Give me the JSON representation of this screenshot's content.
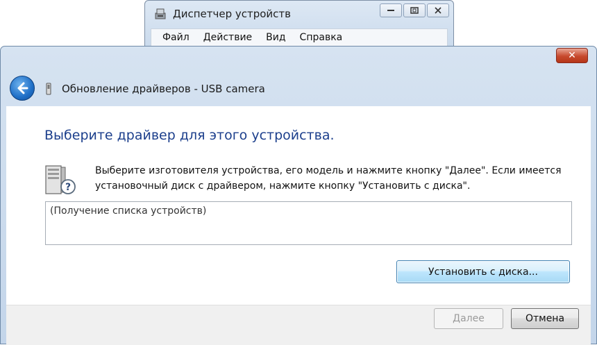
{
  "background_window": {
    "title": "Диспетчер устройств",
    "menu": [
      "Файл",
      "Действие",
      "Вид",
      "Справка"
    ]
  },
  "dialog": {
    "title": "Обновление драйверов - USB camera",
    "main_instruction": "Выберите драйвер для этого устройства.",
    "description": "Выберите изготовителя устройства, его модель и нажмите кнопку \"Далее\". Если имеется установочный диск с  драйвером, нажмите кнопку \"Установить с диска\".",
    "list_placeholder": "(Получение списка устройств)",
    "have_disk_label": "Установить с диска...",
    "next_label": "Далее",
    "cancel_label": "Отмена",
    "close_glyph": "✕"
  },
  "colors": {
    "instruction_blue": "#1c3f8c",
    "back_button_blue": "#1f6fc7",
    "close_red": "#c7492e"
  },
  "icons": [
    "device-manager-icon",
    "back-arrow-icon",
    "usb-device-icon",
    "driver-question-icon",
    "close-icon",
    "minimize-icon",
    "maximize-icon"
  ]
}
